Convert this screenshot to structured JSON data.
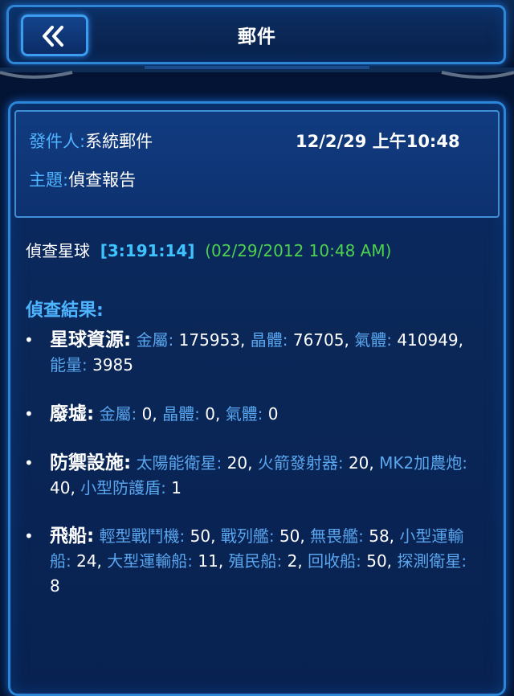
{
  "header": {
    "title": "郵件",
    "back_icon": "double-chevron-left-icon"
  },
  "mail": {
    "sender_label": "發件人:",
    "sender": "系統郵件",
    "date": "12/2/29 上午10:48",
    "subject_label": "主題:",
    "subject": "偵查報告"
  },
  "report": {
    "scan_label": "偵查星球",
    "coords": "[3:191:14]",
    "timestamp": "(02/29/2012 10:48 AM)",
    "results_title": "偵查結果:",
    "resources": {
      "heading": "星球資源:",
      "metal_label": "金屬:",
      "metal": "175953,",
      "crystal_label": "晶體:",
      "crystal": "76705,",
      "gas_label": "氣體:",
      "gas": "410949,",
      "energy_label": "能量:",
      "energy": "3985"
    },
    "debris": {
      "heading": "廢墟:",
      "metal_label": "金屬:",
      "metal": "0,",
      "crystal_label": "晶體:",
      "crystal": "0,",
      "gas_label": "氣體:",
      "gas": "0"
    },
    "defense": {
      "heading": "防禦設施:",
      "solar_label": "太陽能衛星:",
      "solar": "20,",
      "rocket_label": "火箭發射器:",
      "rocket": "20,",
      "gauss_label": "MK2加農炮:",
      "gauss": "40,",
      "shield_label": "小型防護盾:",
      "shield": "1"
    },
    "ships": {
      "heading": "飛船:",
      "light_fighter_label": "輕型戰鬥機:",
      "light_fighter": "50,",
      "battleship_label": "戰列艦:",
      "battleship": "50,",
      "fearless_label": "無畏艦:",
      "fearless": "58,",
      "small_cargo_label": "小型運輸船:",
      "small_cargo": "24,",
      "large_cargo_label": "大型運輸船:",
      "large_cargo": "11,",
      "colony_label": "殖民船:",
      "colony": "2,",
      "recycler_label": "回收船:",
      "recycler": "50,",
      "probe_label": "探測衛星:",
      "probe": "8"
    },
    "bullet": "•"
  }
}
